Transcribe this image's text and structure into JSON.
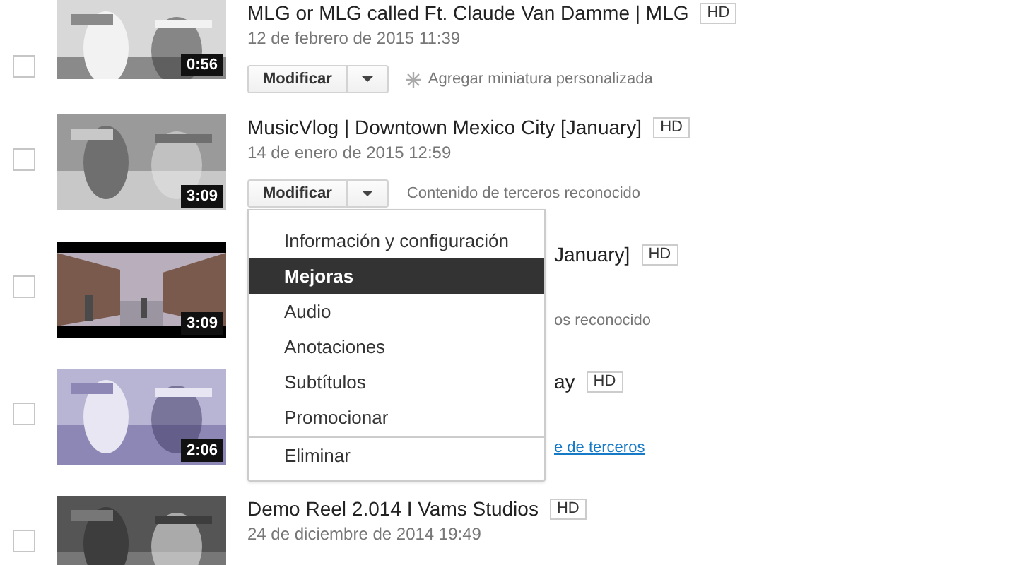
{
  "videos": [
    {
      "checked": false,
      "title": "MLG or MLG called Ft. Claude Van Damme | MLG",
      "hd": "HD",
      "date": "12 de febrero de 2015 11:39",
      "duration": "0:56",
      "edit_button": "Modificar",
      "note": {
        "kind": "hint",
        "text": "Agregar miniatura personalizada"
      }
    },
    {
      "checked": false,
      "title": "MusicVlog | Downtown Mexico City [January]",
      "hd": "HD",
      "date": "14 de enero de 2015 12:59",
      "duration": "3:09",
      "edit_button": "Modificar",
      "note": {
        "kind": "plain",
        "text": "Contenido de terceros reconocido"
      }
    },
    {
      "checked": false,
      "title": "January]",
      "hd": "HD",
      "duration": "3:09",
      "note": {
        "kind": "plain",
        "text": "os reconocido"
      }
    },
    {
      "checked": false,
      "title": "ay",
      "hd": "HD",
      "duration": "2:06",
      "note": {
        "kind": "link",
        "text": "e de terceros"
      }
    },
    {
      "checked": false,
      "title": "Demo Reel 2.014 I Vams Studios",
      "hd": "HD",
      "date": "24 de diciembre de 2014 19:49"
    }
  ],
  "menu": {
    "items": [
      {
        "label": "Información y configuración",
        "selected": false
      },
      {
        "label": "Mejoras",
        "selected": true
      },
      {
        "label": "Audio",
        "selected": false
      },
      {
        "label": "Anotaciones",
        "selected": false
      },
      {
        "label": "Subtítulos",
        "selected": false
      },
      {
        "label": "Promocionar",
        "selected": false
      },
      {
        "label": "Eliminar",
        "selected": false,
        "separated": true
      }
    ]
  }
}
